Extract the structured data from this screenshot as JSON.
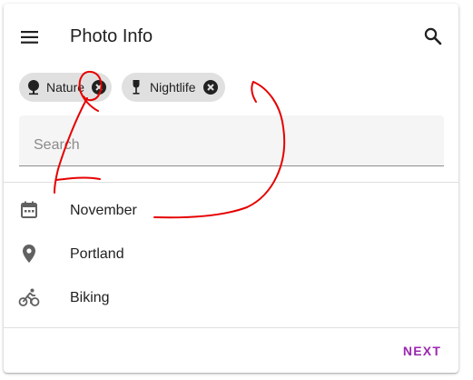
{
  "header": {
    "title": "Photo Info",
    "menu_icon": "menu-icon",
    "search_icon": "search-icon"
  },
  "chips": [
    {
      "label": "Nature",
      "icon": "tree-icon",
      "remove_icon": "cancel-circle-icon"
    },
    {
      "label": "Nightlife",
      "icon": "wine-glass-icon",
      "remove_icon": "cancel-circle-icon"
    }
  ],
  "search": {
    "placeholder": "Search",
    "value": ""
  },
  "list": [
    {
      "label": "November",
      "icon": "calendar-icon"
    },
    {
      "label": "Portland",
      "icon": "location-pin-icon"
    },
    {
      "label": "Biking",
      "icon": "bike-icon"
    }
  ],
  "footer": {
    "next_label": "NEXT"
  },
  "colors": {
    "accent": "#9c27b0",
    "icon": "#616161",
    "chip_bg": "#e0e0e0",
    "field_bg": "#f5f5f5",
    "annotation": "#e60000"
  }
}
